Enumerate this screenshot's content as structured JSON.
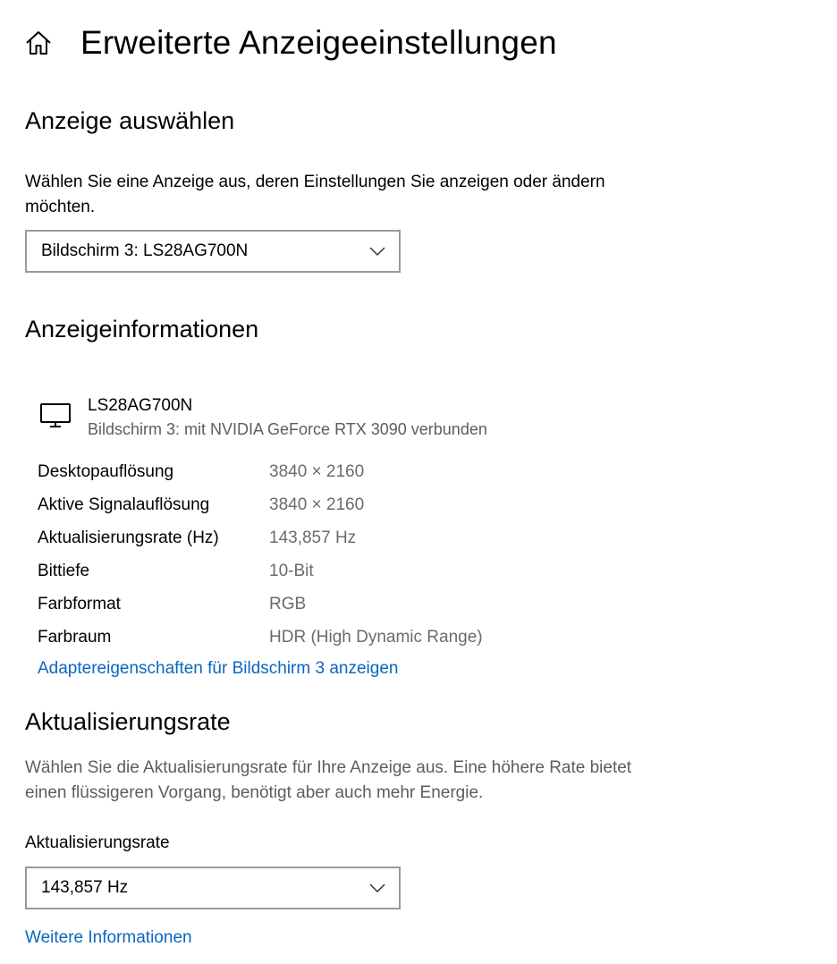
{
  "header": {
    "title": "Erweiterte Anzeigeeinstellungen",
    "home_icon": "home-icon"
  },
  "select_display": {
    "title": "Anzeige auswählen",
    "description": "Wählen Sie eine Anzeige aus, deren Einstellungen Sie anzeigen oder ändern möchten.",
    "dropdown_value": "Bildschirm 3: LS28AG700N"
  },
  "display_info": {
    "title": "Anzeigeinformationen",
    "monitor_icon": "monitor-icon",
    "monitor_name": "LS28AG700N",
    "monitor_subtitle": "Bildschirm 3: mit NVIDIA GeForce RTX 3090 verbunden",
    "rows": [
      {
        "label": "Desktopauflösung",
        "value": "3840 × 2160"
      },
      {
        "label": "Aktive Signalauflösung",
        "value": "3840 × 2160"
      },
      {
        "label": "Aktualisierungsrate (Hz)",
        "value": "143,857 Hz"
      },
      {
        "label": "Bittiefe",
        "value": "10-Bit"
      },
      {
        "label": "Farbformat",
        "value": "RGB"
      },
      {
        "label": "Farbraum",
        "value": "HDR (High Dynamic Range)"
      }
    ],
    "adapter_link": "Adaptereigenschaften für Bildschirm 3 anzeigen"
  },
  "refresh_rate": {
    "title": "Aktualisierungsrate",
    "description": "Wählen Sie die Aktualisierungsrate für Ihre Anzeige aus. Eine höhere Rate bietet einen flüssigeren Vorgang, benötigt aber auch mehr Energie.",
    "field_label": "Aktualisierungsrate",
    "dropdown_value": "143,857 Hz",
    "more_info_link": "Weitere Informationen"
  },
  "colors": {
    "link": "#0a66c0",
    "secondary_text": "#5d5d5d",
    "dropdown_border": "#9a9a9a"
  }
}
